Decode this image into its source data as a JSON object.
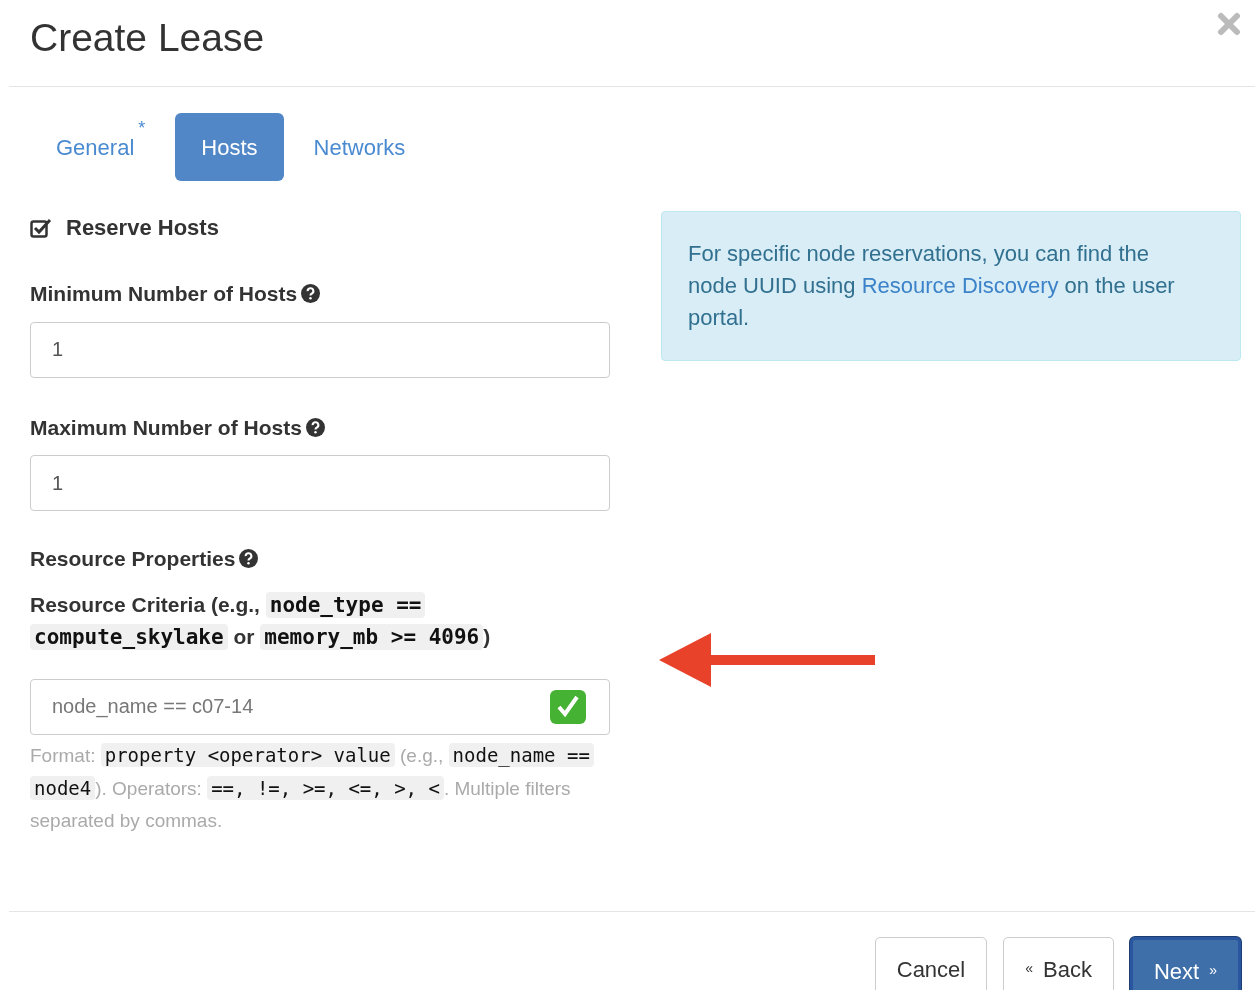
{
  "title": "Create Lease",
  "tabs": [
    {
      "label": "General",
      "marker": "*",
      "selected": false
    },
    {
      "label": "Hosts",
      "selected": true
    },
    {
      "label": "Networks",
      "selected": false
    }
  ],
  "reserve": {
    "label": "Reserve Hosts",
    "checked": true
  },
  "min_hosts": {
    "label": "Minimum Number of Hosts",
    "value": "1"
  },
  "max_hosts": {
    "label": "Maximum Number of Hosts",
    "value": "1"
  },
  "resource_properties": {
    "label": "Resource Properties"
  },
  "criteria_label": [
    {
      "kind": "text",
      "text": "Resource Criteria (e.g., "
    },
    {
      "kind": "code",
      "text": "node_type == compute_skylake"
    },
    {
      "kind": "text",
      "text": " or "
    },
    {
      "kind": "code",
      "text": "memory_mb >= 4096"
    },
    {
      "kind": "text",
      "text": ")"
    }
  ],
  "criteria_field": {
    "placeholder": "node_name == c07-14",
    "valid": true
  },
  "help": [
    {
      "kind": "text",
      "text": "Format: "
    },
    {
      "kind": "code",
      "text": "property <operator> value"
    },
    {
      "kind": "text",
      "text": " (e.g., "
    },
    {
      "kind": "code",
      "text": "node_name == node4"
    },
    {
      "kind": "text",
      "text": "). Operators: "
    },
    {
      "kind": "code",
      "text": "==, !=, >=, <=, >, <"
    },
    {
      "kind": "text",
      "text": ". Multiple filters separated by commas."
    }
  ],
  "info": {
    "before": "For specific node reservations, you can find the node UUID using ",
    "link": "Resource Discovery",
    "after": " on the user portal."
  },
  "buttons": [
    {
      "label": "Cancel",
      "kind": "cancel"
    },
    {
      "label": "Back",
      "kind": "back",
      "prefix": "«"
    },
    {
      "label": "Next",
      "kind": "next",
      "suffix": "»"
    }
  ]
}
